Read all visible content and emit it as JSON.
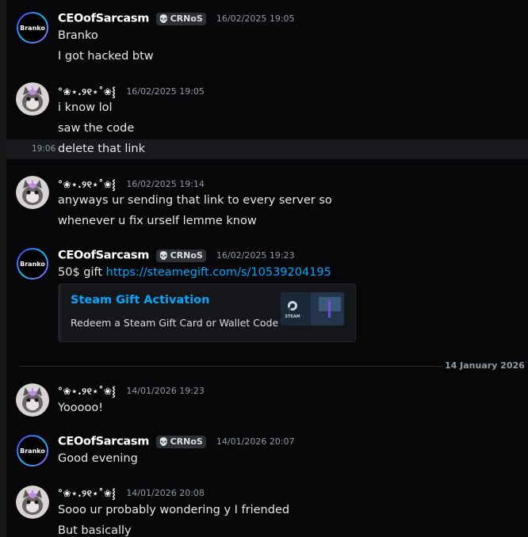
{
  "users": {
    "ceo": {
      "name": "CEOofSarcasm",
      "tag": "CRNoS",
      "avatar_text": "Branko"
    },
    "flower": {
      "name_a": "°❀⋆.୨୧⋆˚❀⸾",
      "name_b": "°❀⋆.୨୧⋆˚❀⸾"
    }
  },
  "messages": [
    {
      "id": "m1",
      "author": "CEOofSarcasm",
      "tag": "CRNoS",
      "timestamp": "16/02/2025 19:05",
      "lines": [
        "Branko",
        "I got hacked btw"
      ]
    },
    {
      "id": "m2",
      "author": "°❀⋆.୨୧⋆˚❀⸾",
      "timestamp": "16/02/2025 19:05",
      "lines": [
        "i know lol",
        "saw the code",
        "delete that link"
      ],
      "hover_time": "19:06"
    },
    {
      "id": "m3",
      "author": "°❀⋆.୨୧⋆˚❀⸾",
      "timestamp": "16/02/2025 19:14",
      "lines": [
        "anyways ur sending that link to every server so",
        "whenever u fix urself lemme know"
      ]
    },
    {
      "id": "m4",
      "author": "CEOofSarcasm",
      "tag": "CRNoS",
      "timestamp": "16/02/2025 19:23",
      "text_prefix": "50$ gift ",
      "link": "https://steamegift.com/s/10539204195",
      "embed": {
        "title": "Steam Gift Activation",
        "description": "Redeem a Steam Gift Card or Wallet Code",
        "thumb_label": "STEAM"
      }
    },
    {
      "id": "m5",
      "author": "°❀⋆.୨୧⋆˚❀⸾",
      "timestamp": "14/01/2026 19:23",
      "lines": [
        "Yooooo!"
      ]
    },
    {
      "id": "m6",
      "author": "CEOofSarcasm",
      "tag": "CRNoS",
      "timestamp": "14/01/2026 20:07",
      "lines": [
        "Good evening"
      ]
    },
    {
      "id": "m7",
      "author": "°❀⋆.୨୧⋆˚❀⸾",
      "timestamp": "14/01/2026 20:08",
      "lines": [
        "Sooo ur probably wondering y I friended",
        "But basically"
      ]
    }
  ],
  "date_divider": "14 January 2026",
  "colors": {
    "background": "#070709",
    "text": "#e6e7ea",
    "muted": "#949ba4",
    "link": "#00a8fc",
    "tag_bg": "#2e2f35",
    "hover_row": "#18191c"
  },
  "icons": {
    "tag": "skull-icon",
    "embed_thumb": "steam-logo-icon"
  }
}
